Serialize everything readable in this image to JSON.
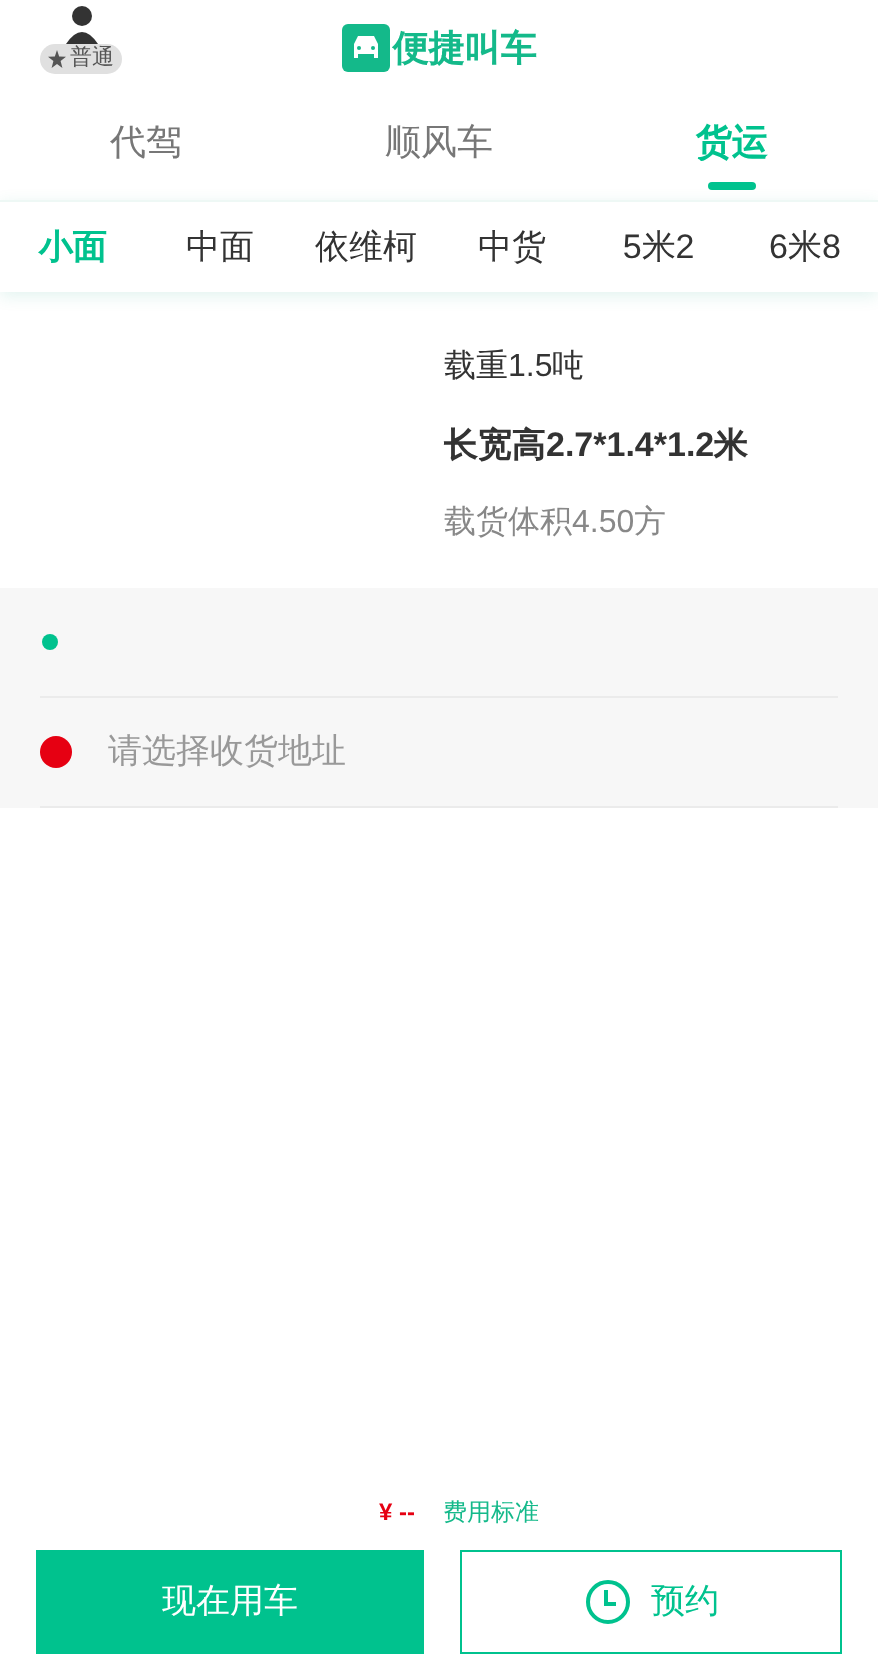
{
  "header": {
    "member_badge": "普通",
    "title": "便捷叫车"
  },
  "tabs": [
    {
      "label": "代驾",
      "selected": false
    },
    {
      "label": "顺风车",
      "selected": false
    },
    {
      "label": "货运",
      "selected": true
    }
  ],
  "vehicle_types": [
    {
      "label": "小面",
      "selected": true
    },
    {
      "label": "中面",
      "selected": false
    },
    {
      "label": "依维柯",
      "selected": false
    },
    {
      "label": "中货",
      "selected": false
    },
    {
      "label": "5米2",
      "selected": false
    },
    {
      "label": "6米8",
      "selected": false
    }
  ],
  "vehicle_info": {
    "load": "载重1.5吨",
    "dimensions": "长宽高2.7*1.4*1.2米",
    "volume": "载货体积4.50方"
  },
  "addresses": [
    {
      "color": "#00c28e"
    },
    {
      "placeholder": "请选择收货地址",
      "color": "#e60012"
    }
  ],
  "fare": {
    "price": "¥ --",
    "link": "费用标准"
  },
  "buttons": {
    "now": "现在用车",
    "reserve": "预约"
  }
}
